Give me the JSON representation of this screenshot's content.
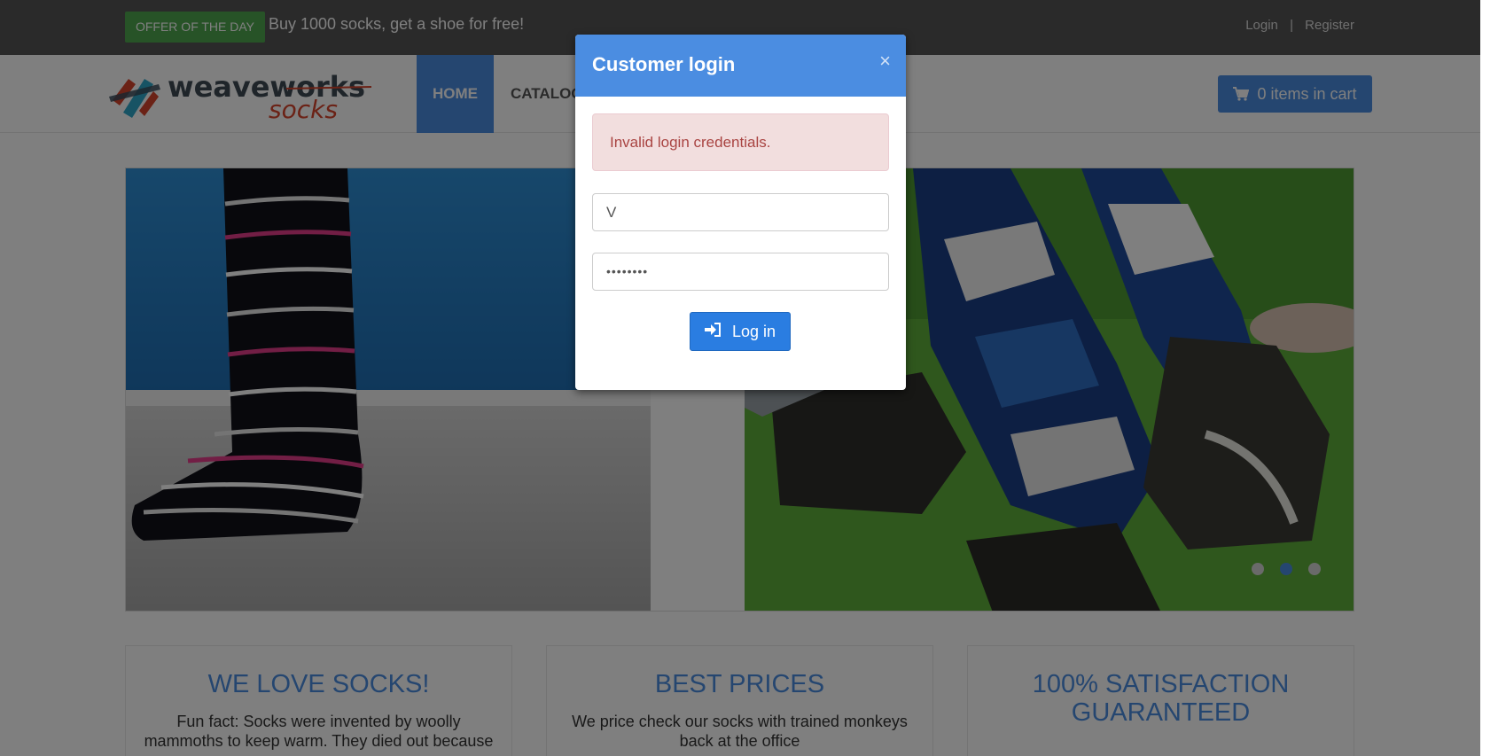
{
  "topbar": {
    "offer_badge": "OFFER OF THE DAY",
    "offer_text": "Buy 1000 socks, get a shoe for free!",
    "login_link": "Login",
    "separator": "|",
    "register_link": "Register"
  },
  "navbar": {
    "logo_text_primary": "weaveworks",
    "logo_text_secondary": "socks",
    "home_label": "HOME",
    "catalogue_label": "CATALOG",
    "cart_label": "0 items in cart",
    "cart_icon": "shopping-cart-icon"
  },
  "hero": {
    "left_image": "striped-sock-photo",
    "right_image": "football-socks-photo",
    "carousel_dots": 3,
    "active_dot": 2
  },
  "features": [
    {
      "title": "WE LOVE SOCKS!",
      "text": "Fun fact: Socks were invented by woolly mammoths to keep warm. They died out because"
    },
    {
      "title": "BEST PRICES",
      "text": "We price check our socks with trained monkeys back at the office"
    },
    {
      "title": "100% SATISFACTION GUARANTEED",
      "text": ""
    }
  ],
  "modal": {
    "title": "Customer login",
    "close_symbol": "×",
    "error_message": "Invalid login credentials.",
    "username_value": "V",
    "password_value": "••••••••",
    "login_button": "Log in",
    "login_icon": "sign-in-icon"
  },
  "colors": {
    "accent": "#4b8de1",
    "offer_green": "#4fa64f",
    "error_bg": "#f2dede",
    "error_text": "#a94442"
  }
}
